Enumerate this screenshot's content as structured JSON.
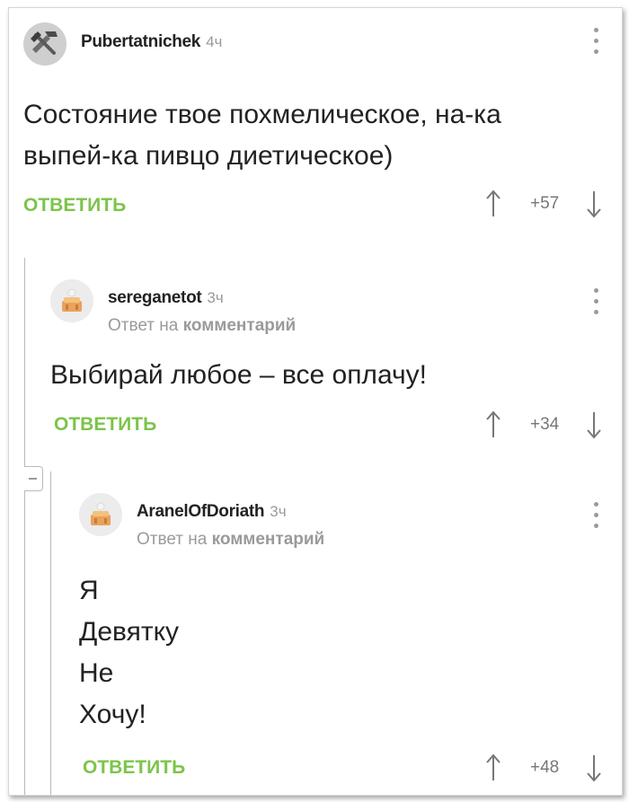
{
  "comments": [
    {
      "username": "Pubertatnichek",
      "time": "4ч",
      "lines": [
        "Состояние твое похмелическое, на-ка",
        "выпей-ка пивцо диетическое)"
      ],
      "reply_label": "ОТВЕТИТЬ",
      "rating": "+57"
    },
    {
      "username": "sereganetot",
      "time": "3ч",
      "reply_prefix": "Ответ на",
      "reply_target": "комментарий",
      "lines": [
        "Выбирай любое – все оплачу!"
      ],
      "reply_label": "ОТВЕТИТЬ",
      "rating": "+34"
    },
    {
      "username": "AranelOfDoriath",
      "time": "3ч",
      "reply_prefix": "Ответ на",
      "reply_target": "комментарий",
      "lines": [
        "Я",
        "Девятку",
        "Не",
        "Хочу!"
      ],
      "reply_label": "ОТВЕТИТЬ",
      "rating": "+48"
    }
  ],
  "colors": {
    "accent": "#7cc44a",
    "muted": "#9a9a9a",
    "text": "#222222"
  },
  "icons": [
    "avatar-hammer-icon",
    "avatar-cake-icon",
    "upvote-arrow-icon",
    "downvote-arrow-icon",
    "more-options-icon",
    "collapse-thread-icon"
  ]
}
